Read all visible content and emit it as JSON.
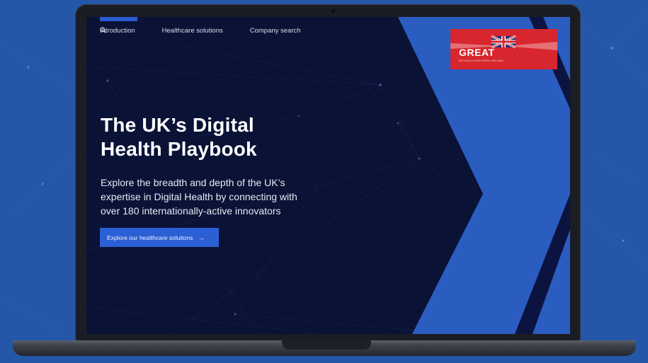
{
  "nav": {
    "items": [
      "Introduction",
      "Healthcare solutions",
      "Company search"
    ],
    "search_icon": "search-icon"
  },
  "hero": {
    "title_lines": [
      "The UK’s Digital",
      "Health Playbook"
    ],
    "description_lines": [
      "Explore the breadth and depth of the UK’s",
      "expertise in Digital Health by connecting with",
      "over 180 internationally-active innovators"
    ],
    "cta_label": "Explore our healthcare solutions",
    "cta_arrow": "→"
  },
  "logo": {
    "word": "GREAT",
    "subtext": "BRITAIN & NORTHERN IRELAND"
  },
  "colors": {
    "background": "#2557a8",
    "screen_navy": "#0a1236",
    "chevron_blue": "#2b5cc0",
    "accent_blue": "#2b5fd4",
    "logo_red": "#d7262e"
  }
}
